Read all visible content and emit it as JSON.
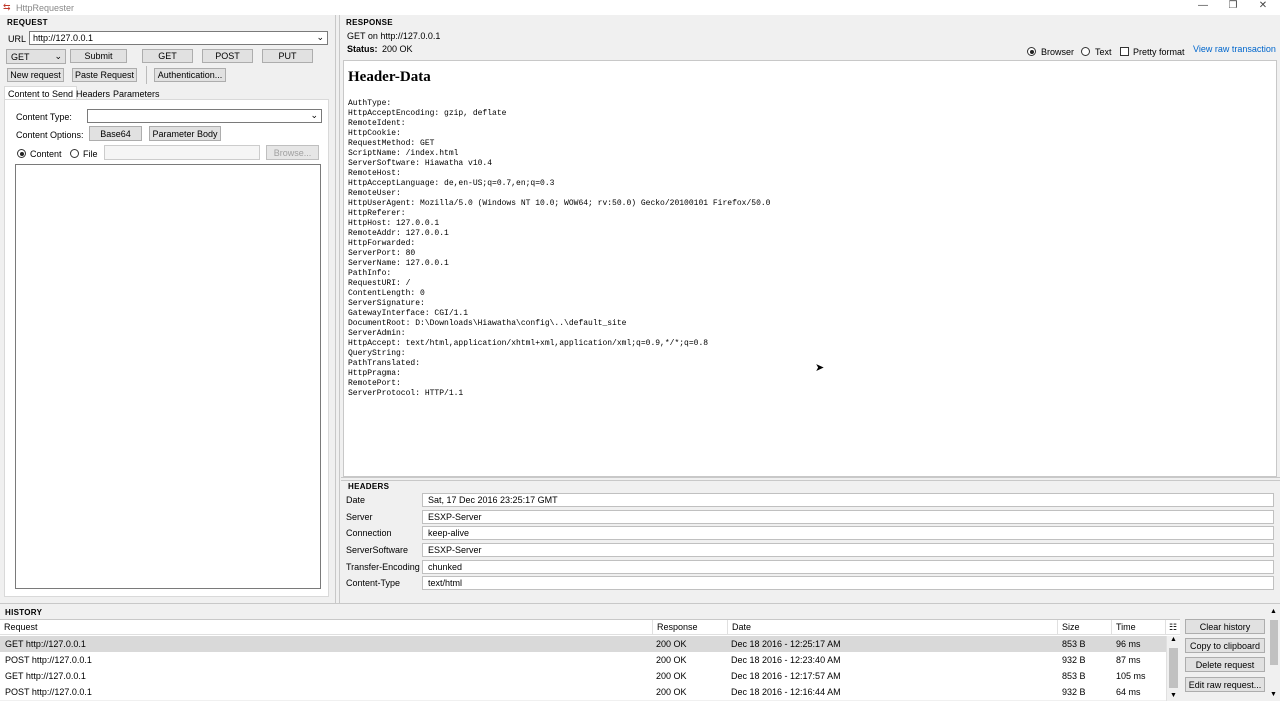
{
  "window": {
    "title": "HttpRequester",
    "controls": [
      "—",
      "❐",
      "✕"
    ]
  },
  "request": {
    "section_title": "Request",
    "url_label": "URL",
    "url_value": "http://127.0.0.1",
    "method_selected": "GET",
    "submit": "Submit",
    "quick_buttons": [
      "GET",
      "POST",
      "PUT"
    ],
    "new_request": "New request",
    "paste_request": "Paste Request",
    "authentication": "Authentication...",
    "tabs": [
      "Content to Send",
      "Headers",
      "Parameters"
    ],
    "content_type_label": "Content Type:",
    "content_type_value": "",
    "content_options_label": "Content Options:",
    "base64": "Base64",
    "parameter_body": "Parameter Body",
    "radio_content": "Content",
    "radio_file": "File",
    "browse": "Browse...",
    "body_text": ""
  },
  "response": {
    "section_title": "Response",
    "summary": "GET on http://127.0.0.1",
    "status_label": "Status:",
    "status_value": "200 OK",
    "view_browser": "Browser",
    "view_text": "Text",
    "pretty_format": "Pretty format",
    "raw_link": "View raw transaction",
    "page_heading": "Header-Data",
    "page_body": "AuthType:\nHttpAcceptEncoding: gzip, deflate\nRemoteIdent:\nHttpCookie:\nRequestMethod: GET\nScriptName: /index.html\nServerSoftware: Hiawatha v10.4\nRemoteHost:\nHttpAcceptLanguage: de,en-US;q=0.7,en;q=0.3\nRemoteUser:\nHttpUserAgent: Mozilla/5.0 (Windows NT 10.0; WOW64; rv:50.0) Gecko/20100101 Firefox/50.0\nHttpReferer:\nHttpHost: 127.0.0.1\nRemoteAddr: 127.0.0.1\nHttpForwarded:\nServerPort: 80\nServerName: 127.0.0.1\nPathInfo:\nRequestURI: /\nContentLength: 0\nServerSignature:\nGatewayInterface: CGI/1.1\nDocumentRoot: D:\\Downloads\\Hiawatha\\config\\..\\default_site\nServerAdmin:\nHttpAccept: text/html,application/xhtml+xml,application/xml;q=0.9,*/*;q=0.8\nQueryString:\nPathTranslated:\nHttpPragma:\nRemotePort:\nServerProtocol: HTTP/1.1"
  },
  "headers": {
    "section_title": "Headers",
    "rows": [
      {
        "key": "Date",
        "value": "Sat, 17 Dec 2016 23:25:17 GMT"
      },
      {
        "key": "Server",
        "value": "ESXP-Server"
      },
      {
        "key": "Connection",
        "value": "keep-alive"
      },
      {
        "key": "ServerSoftware",
        "value": "ESXP-Server"
      },
      {
        "key": "Transfer-Encoding",
        "value": "chunked"
      },
      {
        "key": "Content-Type",
        "value": "text/html"
      }
    ]
  },
  "history": {
    "section_title": "History",
    "columns": [
      "Request",
      "Response",
      "Date",
      "Size",
      "Time"
    ],
    "rows": [
      {
        "request": "GET http://127.0.0.1",
        "response": "200 OK",
        "date": "Dec 18 2016 - 12:25:17 AM",
        "size": "853 B",
        "time": "96 ms"
      },
      {
        "request": "POST http://127.0.0.1",
        "response": "200 OK",
        "date": "Dec 18 2016 - 12:23:40 AM",
        "size": "932 B",
        "time": "87 ms"
      },
      {
        "request": "GET http://127.0.0.1",
        "response": "200 OK",
        "date": "Dec 18 2016 - 12:17:57 AM",
        "size": "853 B",
        "time": "105 ms"
      },
      {
        "request": "POST http://127.0.0.1",
        "response": "200 OK",
        "date": "Dec 18 2016 - 12:16:44 AM",
        "size": "932 B",
        "time": "64 ms"
      }
    ],
    "clear": "Clear history",
    "copy": "Copy to clipboard",
    "delete": "Delete request",
    "edit_raw": "Edit raw request..."
  },
  "colors": {
    "link": "#0066cc",
    "selected_row": "#d9d9d9"
  }
}
